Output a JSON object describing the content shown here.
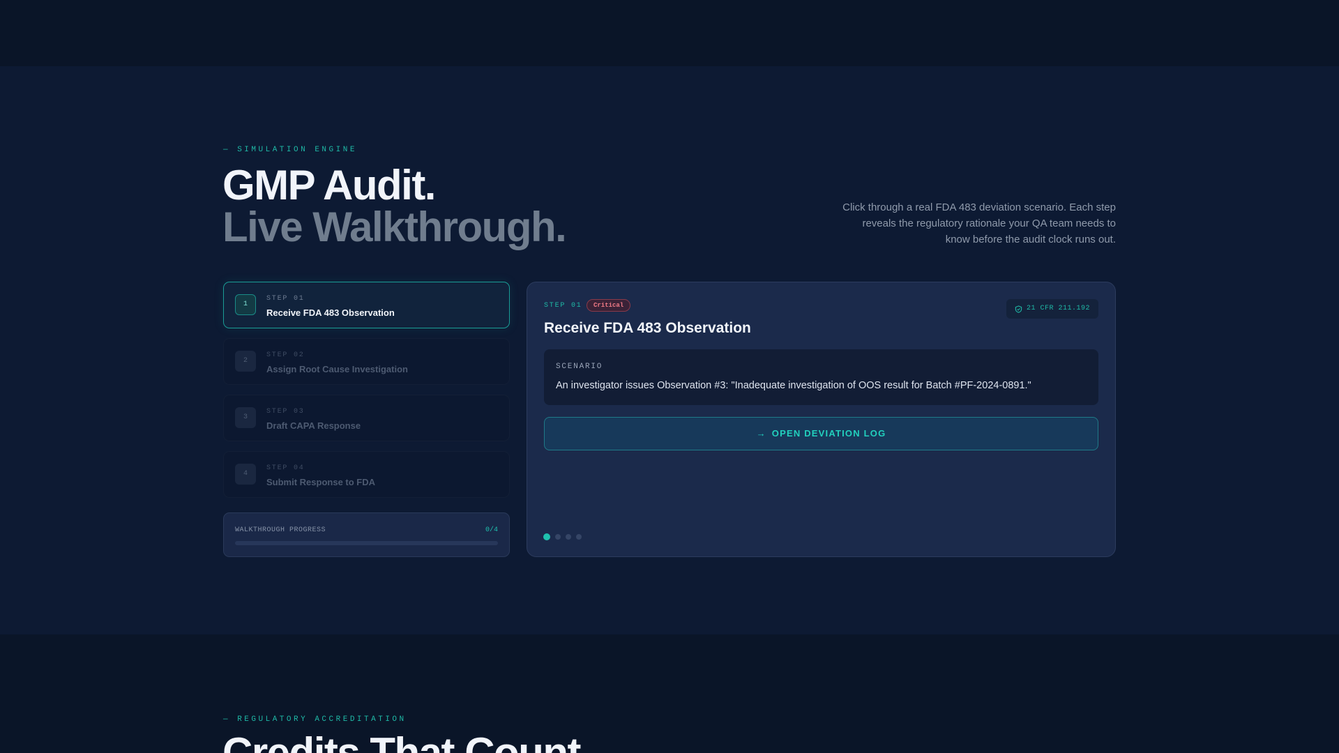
{
  "hero": {
    "eyebrow": "— SIMULATION ENGINE",
    "title_line1": "GMP Audit.",
    "title_line2": "Live Walkthrough.",
    "intro": "Click through a real FDA 483 deviation scenario. Each step reveals the regulatory rationale your QA team needs to know before the audit clock runs out."
  },
  "steps": [
    {
      "number": "1",
      "label": "STEP 01",
      "title": "Receive FDA 483 Observation",
      "active": true
    },
    {
      "number": "2",
      "label": "STEP 02",
      "title": "Assign Root Cause Investigation",
      "active": false
    },
    {
      "number": "3",
      "label": "STEP 03",
      "title": "Draft CAPA Response",
      "active": false
    },
    {
      "number": "4",
      "label": "STEP 04",
      "title": "Submit Response to FDA",
      "active": false
    }
  ],
  "progress": {
    "label": "WALKTHROUGH PROGRESS",
    "count": "0/4",
    "value": 0
  },
  "detail": {
    "step_label": "STEP 01",
    "severity": "Critical",
    "cfr_reference": "21 CFR 211.192",
    "cfr_icon": "shield-icon",
    "title": "Receive FDA 483 Observation",
    "scenario_label": "SCENARIO",
    "scenario_text": "An investigator issues Observation #3: \"Inadequate investigation of OOS result for Batch #PF-2024-0891.\"",
    "action_arrow": "→",
    "action_label": "OPEN DEVIATION LOG",
    "pagination_total": 4,
    "pagination_active": 1
  },
  "accreditation": {
    "eyebrow": "— REGULATORY ACCREDITATION",
    "title": "Credits That Count."
  },
  "colors": {
    "accent": "#1fc1ae",
    "critical": "#f07a86",
    "background": "#0d1a33",
    "card": "#1b2a4b"
  }
}
